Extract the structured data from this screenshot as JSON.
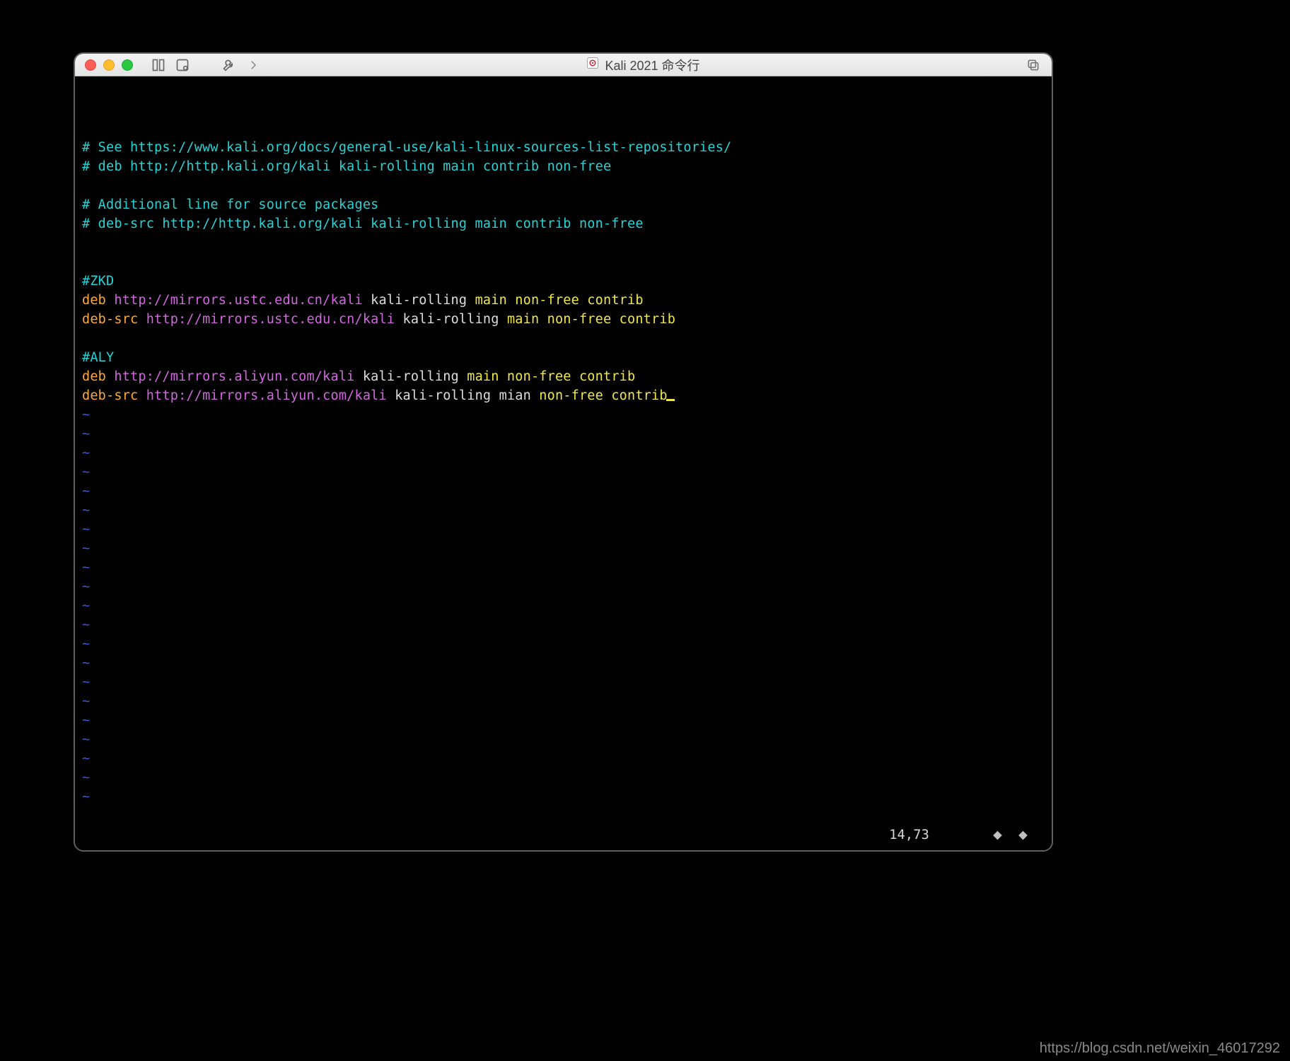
{
  "titlebar": {
    "window_title": "Kali 2021 命令行"
  },
  "editor": {
    "lines": [
      [
        {
          "cls": "c-comment",
          "t": "# See https://www.kali.org/docs/general-use/kali-linux-sources-list-repositories/"
        }
      ],
      [
        {
          "cls": "c-comment",
          "t": "# deb http://http.kali.org/kali kali-rolling main contrib non-free"
        }
      ],
      [],
      [
        {
          "cls": "c-comment",
          "t": "# Additional line for source packages"
        }
      ],
      [
        {
          "cls": "c-comment",
          "t": "# deb-src http://http.kali.org/kali kali-rolling main contrib non-free"
        }
      ],
      [],
      [],
      [
        {
          "cls": "c-comment",
          "t": "#ZKD"
        }
      ],
      [
        {
          "cls": "c-deb",
          "t": "deb "
        },
        {
          "cls": "c-url",
          "t": "http://mirrors.ustc.edu.cn/kali"
        },
        {
          "cls": "c-plain",
          "t": " kali-rolling "
        },
        {
          "cls": "c-section",
          "t": "main non-free contrib"
        }
      ],
      [
        {
          "cls": "c-deb",
          "t": "deb-src "
        },
        {
          "cls": "c-url",
          "t": "http://mirrors.ustc.edu.cn/kali"
        },
        {
          "cls": "c-plain",
          "t": " kali-rolling "
        },
        {
          "cls": "c-section",
          "t": "main non-free contrib"
        }
      ],
      [],
      [
        {
          "cls": "c-comment",
          "t": "#ALY"
        }
      ],
      [
        {
          "cls": "c-deb",
          "t": "deb "
        },
        {
          "cls": "c-url",
          "t": "http://mirrors.aliyun.com/kali"
        },
        {
          "cls": "c-plain",
          "t": " kali-rolling "
        },
        {
          "cls": "c-section",
          "t": "main non-free contrib"
        }
      ],
      [
        {
          "cls": "c-deb",
          "t": "deb-src "
        },
        {
          "cls": "c-url",
          "t": "http://mirrors.aliyun.com/kali"
        },
        {
          "cls": "c-plain",
          "t": " kali-rolling mian "
        },
        {
          "cls": "c-section",
          "t": "non-free contrib"
        },
        {
          "cls": "cursor",
          "t": ""
        }
      ]
    ],
    "tilde_rows": 21,
    "tilde_char": "~"
  },
  "status": {
    "cursor_pos": "14,73",
    "scroll_icons": "⬥ ⬥"
  },
  "watermark": "https://blog.csdn.net/weixin_46017292"
}
